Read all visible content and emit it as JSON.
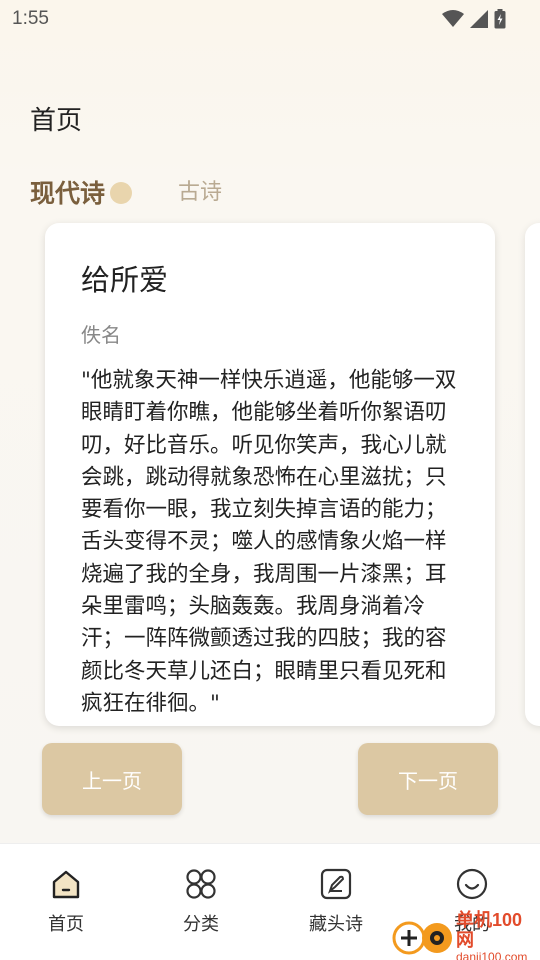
{
  "status_bar": {
    "time": "1:55"
  },
  "header": {
    "title": "首页"
  },
  "tabs": [
    {
      "label": "现代诗",
      "active": true
    },
    {
      "label": "古诗",
      "active": false
    }
  ],
  "poem": {
    "title": "给所爱",
    "author": "佚名",
    "content": "\"他就象天神一样快乐逍遥，他能够一双眼睛盯着你瞧，他能够坐着听你絮语叨叨，好比音乐。听见你笑声，我心儿就会跳，跳动得就象恐怖在心里滋扰；只要看你一眼，我立刻失掉言语的能力；舌头变得不灵；噬人的感情象火焰一样烧遍了我的全身，我周围一片漆黑；耳朵里雷鸣；头脑轰轰。我周身淌着冷汗；一阵阵微颤透过我的四肢；我的容颜比冬天草儿还白；眼睛里只看见死和疯狂在徘徊。\""
  },
  "buttons": {
    "prev": "上一页",
    "next": "下一页"
  },
  "nav": [
    {
      "label": "首页",
      "icon": "home-icon"
    },
    {
      "label": "分类",
      "icon": "category-icon"
    },
    {
      "label": "藏头诗",
      "icon": "acrostic-icon"
    },
    {
      "label": "我的",
      "icon": "profile-icon"
    }
  ],
  "watermark": {
    "name": "单机100网",
    "url": "danji100.com"
  },
  "colors": {
    "accent": "#7a5f3d",
    "button": "#dcc8a3",
    "inactive_tab": "#b9aa92",
    "watermark": "#e24b2b"
  }
}
